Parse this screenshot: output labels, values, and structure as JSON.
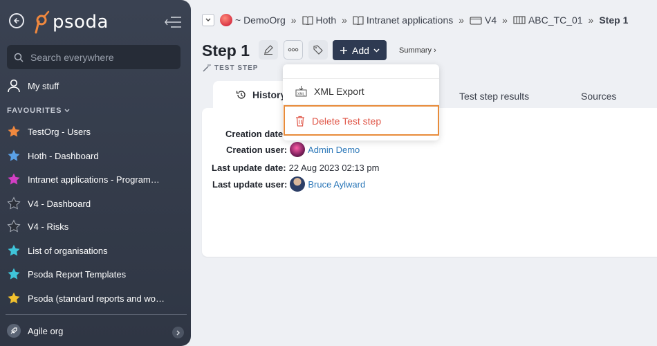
{
  "sidebar": {
    "logo_text": "psoda",
    "search_placeholder": "Search everywhere",
    "my_stuff": "My stuff",
    "favourites_header": "FAVOURITES",
    "favourites": [
      {
        "label": "TestOrg - Users",
        "star_color": "#f0883e"
      },
      {
        "label": "Hoth - Dashboard",
        "star_color": "#5aa0e6"
      },
      {
        "label": "Intranet applications - Programme...",
        "star_color": "#d23fc4"
      },
      {
        "label": "V4 - Dashboard",
        "star_color": "#2b2f38"
      },
      {
        "label": "V4 - Risks",
        "star_color": "#2b2f38"
      },
      {
        "label": "List of organisations",
        "star_color": "#3fc4d9"
      },
      {
        "label": "Psoda Report Templates",
        "star_color": "#3fc4d9"
      },
      {
        "label": "Psoda (standard reports and work...",
        "star_color": "#f2c12e"
      }
    ],
    "org_name": "Agile org"
  },
  "breadcrumb": {
    "items": [
      {
        "label": "~ DemoOrg",
        "icon": "org-avatar-icon"
      },
      {
        "label": "Hoth",
        "icon": "book-icon"
      },
      {
        "label": "Intranet applications",
        "icon": "book-icon"
      },
      {
        "label": "V4",
        "icon": "folder-icon"
      },
      {
        "label": "ABC_TC_01",
        "icon": "test-case-icon"
      }
    ],
    "current": "Step 1",
    "separator": "»"
  },
  "page": {
    "title": "Step 1",
    "subtitle": "TEST STEP",
    "add_label": "Add",
    "summary_link": "Summary ›"
  },
  "tabs": {
    "history": "History",
    "test_step_results": "Test step results",
    "sources": "Sources"
  },
  "dropdown": {
    "xml_export": "XML Export",
    "delete": "Delete Test step",
    "delete_color": "#e0584a"
  },
  "history": {
    "creation_date_label": "Creation date",
    "creation_user_label": "Creation user:",
    "creation_user": "Admin Demo",
    "last_update_date_label": "Last update date:",
    "last_update_date": "22 Aug 2023 02:13 pm",
    "last_update_user_label": "Last update user:",
    "last_update_user": "Bruce Aylward"
  },
  "colors": {
    "accent": "#f0883e",
    "link": "#2b77b8",
    "sidebar_bg": "#3a4252",
    "highlight_border": "#e88b3a"
  }
}
